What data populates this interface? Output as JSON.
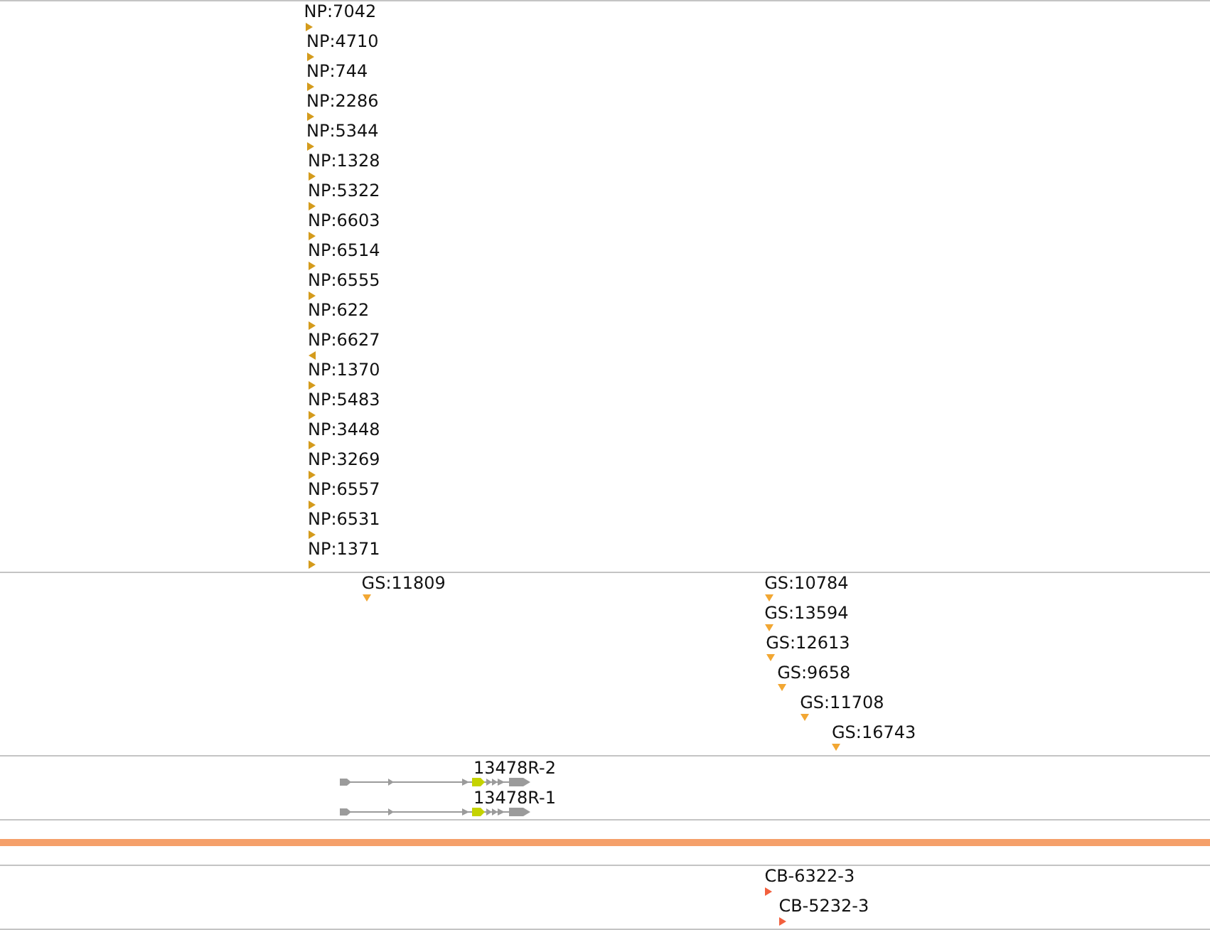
{
  "tracks": [
    {
      "kind": "stranded",
      "color": "#d49b1c",
      "features": [
        {
          "label": "NP:7042",
          "reverse": false
        },
        {
          "label": "NP:4710",
          "reverse": false
        },
        {
          "label": "NP:744",
          "reverse": false
        },
        {
          "label": "NP:2286",
          "reverse": false
        },
        {
          "label": "NP:5344",
          "reverse": false
        },
        {
          "label": "NP:1328",
          "reverse": false
        },
        {
          "label": "NP:5322",
          "reverse": false
        },
        {
          "label": "NP:6603",
          "reverse": false
        },
        {
          "label": "NP:6514",
          "reverse": false
        },
        {
          "label": "NP:6555",
          "reverse": false
        },
        {
          "label": "NP:622",
          "reverse": false
        },
        {
          "label": "NP:6627",
          "reverse": true
        },
        {
          "label": "NP:1370",
          "reverse": false
        },
        {
          "label": "NP:5483",
          "reverse": false
        },
        {
          "label": "NP:3448",
          "reverse": false
        },
        {
          "label": "NP:3269",
          "reverse": false
        },
        {
          "label": "NP:6557",
          "reverse": false
        },
        {
          "label": "NP:6531",
          "reverse": false
        },
        {
          "label": "NP:1371",
          "reverse": false
        }
      ]
    },
    {
      "kind": "sites",
      "color": "#f2a733",
      "features": [
        {
          "label": "GS:11809"
        },
        {
          "label": "GS:10784"
        },
        {
          "label": "GS:13594"
        },
        {
          "label": "GS:12613"
        },
        {
          "label": "GS:9658"
        },
        {
          "label": "GS:11708"
        },
        {
          "label": "GS:16743"
        }
      ]
    },
    {
      "kind": "transcripts",
      "transcripts": [
        {
          "label": "13478R-2"
        },
        {
          "label": "13478R-1"
        }
      ]
    },
    {
      "kind": "band"
    },
    {
      "kind": "stranded",
      "color": "#f2603e",
      "features": [
        {
          "label": "CB-6322-3",
          "reverse": false
        },
        {
          "label": "CB-5232-3",
          "reverse": false
        }
      ]
    }
  ]
}
